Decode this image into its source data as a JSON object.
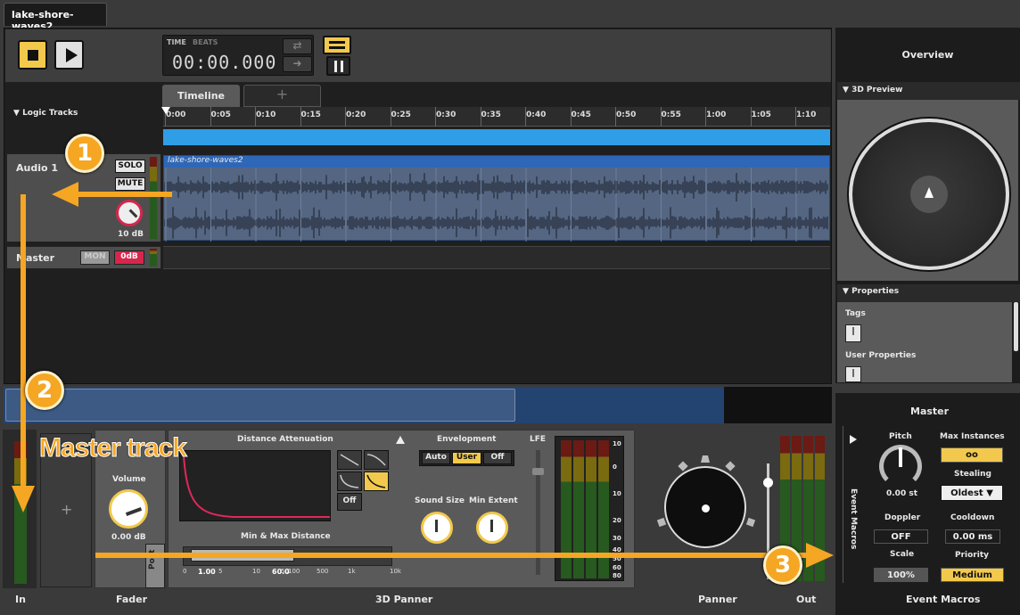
{
  "file_tab": "lake-shore-waves2",
  "transport": {
    "time_label": "TIME",
    "beats_label": "BEATS",
    "time_value": "00:00.000"
  },
  "timeline": {
    "tab_label": "Timeline",
    "add_tab": "+",
    "logic_tracks": "Logic Tracks",
    "ticks": [
      "0:00",
      "0:05",
      "0:10",
      "0:15",
      "0:20",
      "0:25",
      "0:30",
      "0:35",
      "0:40",
      "0:45",
      "0:50",
      "0:55",
      "1:00",
      "1:05",
      "1:10"
    ]
  },
  "tracks": {
    "audio1": {
      "name": "Audio 1",
      "solo": "SOLO",
      "mute": "MUTE",
      "gain": "10 dB"
    },
    "master": {
      "name": "Master",
      "mon": "MON",
      "level": "0dB"
    },
    "clip_name": "lake-shore-waves2"
  },
  "overview": {
    "title": "Overview",
    "preview": "3D Preview",
    "properties": "Properties",
    "tags": "Tags",
    "user_properties": "User Properties"
  },
  "deck": {
    "in": "In",
    "fader": "Fader",
    "panner3d": "3D Panner",
    "panner": "Panner",
    "out": "Out",
    "event_macros": "Event Macros",
    "add_plus": "+",
    "volume_label": "Volume",
    "volume_value": "0.00 dB",
    "post": "Post",
    "distance_attenuation": "Distance Attenuation",
    "min_max_distance": "Min & Max Distance",
    "scale_marks": [
      "0",
      "1",
      "5",
      "10",
      "50",
      "100",
      "500",
      "1k",
      "10k"
    ],
    "min_val": "1.00",
    "max_val": "60.0",
    "curve_off": "Off",
    "envelopment": "Envelopment",
    "env_options": [
      "Auto",
      "User",
      "Off"
    ],
    "env_selected": "User",
    "sound_size": "Sound Size",
    "min_extent": "Min Extent",
    "lfe": "LFE",
    "meter_marks": [
      "10",
      "0",
      "10",
      "20",
      "30",
      "40",
      "50",
      "60",
      "80"
    ]
  },
  "macros": {
    "title": "Master",
    "vertical_label": "Event Macros",
    "pitch": "Pitch",
    "pitch_value": "0.00 st",
    "max_instances": "Max Instances",
    "max_instances_value": "oo",
    "stealing": "Stealing",
    "stealing_value": "Oldest",
    "doppler": "Doppler",
    "doppler_value": "OFF",
    "cooldown": "Cooldown",
    "cooldown_value": "0.00 ms",
    "scale": "Scale",
    "scale_value": "100%",
    "priority": "Priority",
    "priority_value": "Medium"
  },
  "annotations": {
    "c1": "1",
    "c2": "2",
    "c3": "3",
    "master_track": "Master track"
  },
  "colors": {
    "accent": "#f2c94c",
    "callout": "#f5a623",
    "region_blue": "#2f9ee6",
    "clip": "#546682",
    "mute_red": "#d7264c"
  }
}
